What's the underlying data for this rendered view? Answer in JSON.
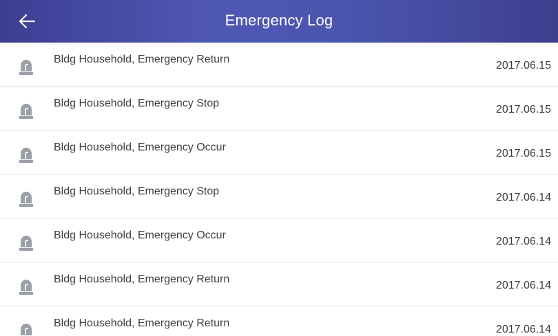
{
  "header": {
    "title": "Emergency Log",
    "back_icon": "arrow-left-icon"
  },
  "colors": {
    "header_gradient_start": "#3c3f93",
    "header_gradient_mid": "#4f58b3",
    "text": "#404040",
    "divider": "#e1e1e1",
    "icon": "#9aa0a8"
  },
  "log": {
    "row_icon": "emergency-siren-icon",
    "entries": [
      {
        "event": "Bldg Household, Emergency Return",
        "date": "2017.06.15"
      },
      {
        "event": "Bldg Household, Emergency Stop",
        "date": "2017.06.15"
      },
      {
        "event": "Bldg Household, Emergency Occur",
        "date": "2017.06.15"
      },
      {
        "event": "Bldg Household, Emergency Stop",
        "date": "2017.06.14"
      },
      {
        "event": "Bldg Household, Emergency Occur",
        "date": "2017.06.14"
      },
      {
        "event": "Bldg Household, Emergency Return",
        "date": "2017.06.14"
      },
      {
        "event": "Bldg Household, Emergency Return",
        "date": "2017.06.14"
      }
    ]
  }
}
